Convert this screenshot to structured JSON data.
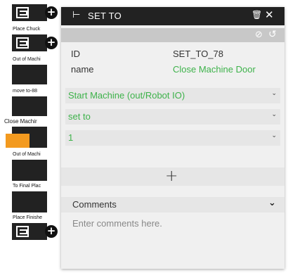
{
  "program_blocks": [
    {
      "label": "Place Chuck"
    },
    {
      "label": "Out of Machi"
    },
    {
      "label": "move to-88"
    },
    {
      "label": "Close Machir"
    },
    {
      "label": "Out of Machi"
    },
    {
      "label": "To Final Plac"
    },
    {
      "label": "Place Finishe"
    }
  ],
  "panel": {
    "title": "SET TO",
    "header_icon": "step-icon",
    "properties": [
      {
        "key": "ID",
        "value": "SET_TO_78"
      },
      {
        "key": "name",
        "value": "Close Machine Door"
      }
    ],
    "dropdowns": [
      {
        "value": "Start Machine (out/Robot IO)"
      },
      {
        "value": "set to"
      },
      {
        "value": "1"
      }
    ],
    "comments": {
      "label": "Comments",
      "placeholder": "Enter comments here."
    }
  },
  "colors": {
    "accent_green": "#3db24a",
    "selected_block": "#f39a1f",
    "header_bg": "#222222"
  }
}
